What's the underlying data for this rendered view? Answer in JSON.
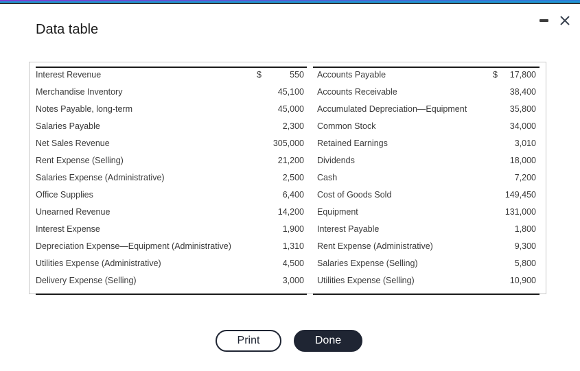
{
  "dialog": {
    "title": "Data table",
    "controls": {
      "minimize_icon": "minimize-icon",
      "close_icon": "close-icon"
    }
  },
  "table": {
    "left": [
      {
        "label": "Interest Revenue",
        "currency": "$",
        "value": "550"
      },
      {
        "label": "Merchandise Inventory",
        "currency": "",
        "value": "45,100"
      },
      {
        "label": "Notes Payable, long-term",
        "currency": "",
        "value": "45,000"
      },
      {
        "label": "Salaries Payable",
        "currency": "",
        "value": "2,300"
      },
      {
        "label": "Net Sales Revenue",
        "currency": "",
        "value": "305,000"
      },
      {
        "label": "Rent Expense (Selling)",
        "currency": "",
        "value": "21,200"
      },
      {
        "label": "Salaries Expense (Administrative)",
        "currency": "",
        "value": "2,500"
      },
      {
        "label": "Office Supplies",
        "currency": "",
        "value": "6,400"
      },
      {
        "label": "Unearned Revenue",
        "currency": "",
        "value": "14,200"
      },
      {
        "label": "Interest Expense",
        "currency": "",
        "value": "1,900"
      },
      {
        "label": "Depreciation Expense—Equipment (Administrative)",
        "currency": "",
        "value": "1,310"
      },
      {
        "label": "Utilities Expense (Administrative)",
        "currency": "",
        "value": "4,500"
      },
      {
        "label": "Delivery Expense (Selling)",
        "currency": "",
        "value": "3,000"
      }
    ],
    "right": [
      {
        "label": "Accounts Payable",
        "currency": "$",
        "value": "17,800"
      },
      {
        "label": "Accounts Receivable",
        "currency": "",
        "value": "38,400"
      },
      {
        "label": "Accumulated Depreciation—Equipment",
        "currency": "",
        "value": "35,800"
      },
      {
        "label": "Common Stock",
        "currency": "",
        "value": "34,000"
      },
      {
        "label": "Retained Earnings",
        "currency": "",
        "value": "3,010"
      },
      {
        "label": "Dividends",
        "currency": "",
        "value": "18,000"
      },
      {
        "label": "Cash",
        "currency": "",
        "value": "7,200"
      },
      {
        "label": "Cost of Goods Sold",
        "currency": "",
        "value": "149,450"
      },
      {
        "label": "Equipment",
        "currency": "",
        "value": "131,000"
      },
      {
        "label": "Interest Payable",
        "currency": "",
        "value": "1,800"
      },
      {
        "label": "Rent Expense (Administrative)",
        "currency": "",
        "value": "9,300"
      },
      {
        "label": "Salaries Expense (Selling)",
        "currency": "",
        "value": "5,800"
      },
      {
        "label": "Utilities Expense (Selling)",
        "currency": "",
        "value": "10,900"
      }
    ]
  },
  "buttons": {
    "print_label": "Print",
    "done_label": "Done"
  },
  "colors": {
    "button_dark": "#1f2533",
    "top_bar_accent": "#1e9ad6"
  }
}
